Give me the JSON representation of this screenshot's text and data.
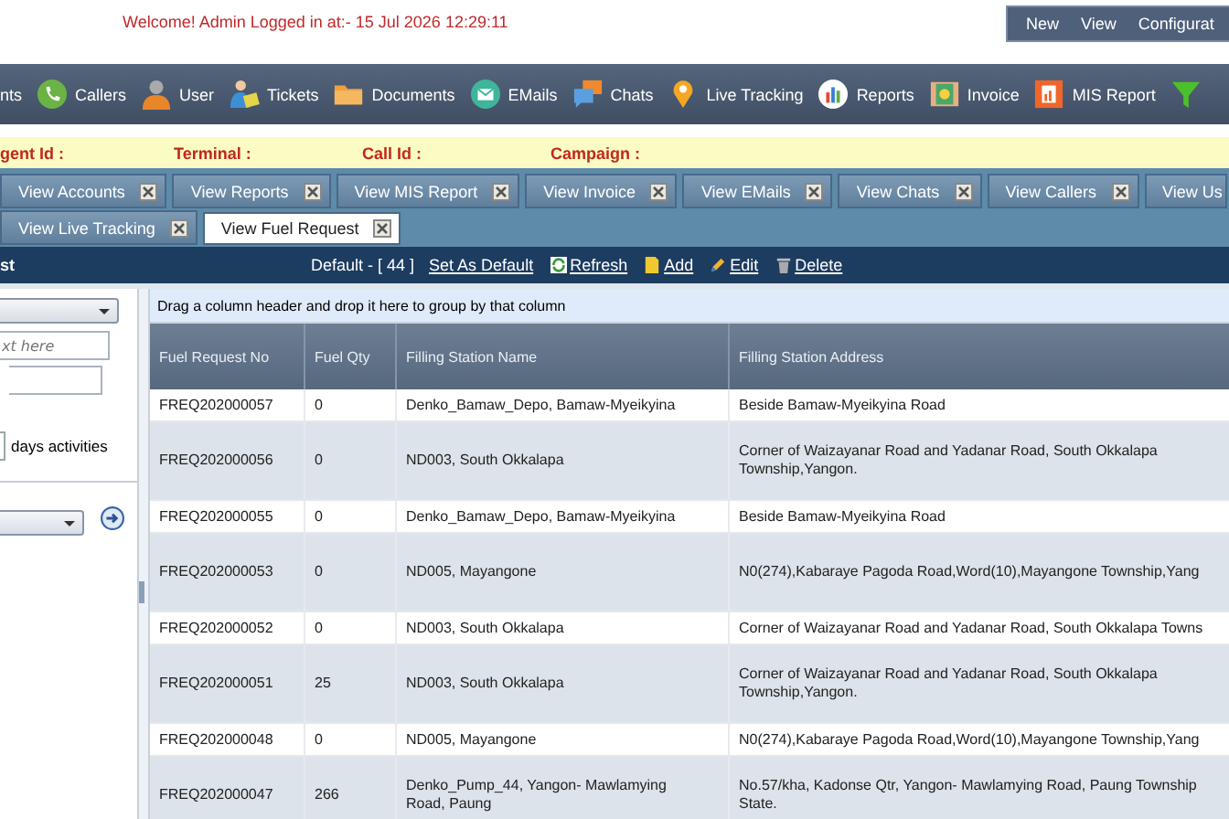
{
  "header": {
    "welcome": "Welcome! Admin Logged in at:- 15 Jul 2026 12:29:11",
    "menu": [
      "New",
      "View",
      "Configurat"
    ]
  },
  "toolbar": [
    {
      "label": "nts",
      "kind": "none"
    },
    {
      "label": "Callers",
      "kind": "phone"
    },
    {
      "label": "User",
      "kind": "user"
    },
    {
      "label": "Tickets",
      "kind": "tickets"
    },
    {
      "label": "Documents",
      "kind": "folder"
    },
    {
      "label": "EMails",
      "kind": "email"
    },
    {
      "label": "Chats",
      "kind": "chats"
    },
    {
      "label": "Live Tracking",
      "kind": "pin"
    },
    {
      "label": "Reports",
      "kind": "reports"
    },
    {
      "label": "Invoice",
      "kind": "invoice"
    },
    {
      "label": "MIS Report",
      "kind": "mis"
    },
    {
      "kind": "funnel"
    }
  ],
  "info_bar": [
    "gent Id :",
    "Terminal :",
    "Call Id :",
    "Campaign :"
  ],
  "tab_rows": [
    [
      {
        "label": "View Accounts",
        "selected": false,
        "closable": true
      },
      {
        "label": "View Reports",
        "selected": false,
        "closable": true
      },
      {
        "label": "View MIS Report",
        "selected": false,
        "closable": true
      },
      {
        "label": "View Invoice",
        "selected": false,
        "closable": true
      },
      {
        "label": "View EMails",
        "selected": false,
        "closable": true
      },
      {
        "label": "View Chats",
        "selected": false,
        "closable": true
      },
      {
        "label": "View Callers",
        "selected": false,
        "closable": true
      },
      {
        "label": "View Us",
        "selected": false,
        "closable": false
      }
    ],
    [
      {
        "label": "View Live Tracking",
        "selected": false,
        "closable": true
      },
      {
        "label": "View Fuel Request",
        "selected": true,
        "closable": true
      }
    ]
  ],
  "action_bar": {
    "title": "st",
    "view": "Default - [ 44 ]",
    "links": [
      {
        "label": "Set As Default",
        "kind": "none"
      },
      {
        "label": "Refresh",
        "kind": "refresh"
      },
      {
        "label": "Add",
        "kind": "add"
      },
      {
        "label": "Edit",
        "kind": "edit"
      },
      {
        "label": "Delete",
        "kind": "delete"
      }
    ]
  },
  "filter_panel": {
    "search_placeholder": "xt here",
    "days_label": "days activities",
    "days_checked": false
  },
  "grid": {
    "group_hint": "Drag a column header and drop it here to group by that column",
    "columns": [
      "Fuel Request No",
      "Fuel Qty",
      "Filling Station Name",
      "Filling Station Address"
    ],
    "rows": [
      {
        "request_no": "FREQ202000057",
        "fuel_qty": "0",
        "station_name": "Denko_Bamaw_Depo, Bamaw-Myeikyina",
        "address": "Beside Bamaw-Myeikyina Road"
      },
      {
        "request_no": "FREQ202000056",
        "fuel_qty": "0",
        "station_name": "ND003, South Okkalapa",
        "address": "Corner of Waizayanar Road and Yadanar Road, South Okkalapa\nTownship,Yangon."
      },
      {
        "request_no": "FREQ202000055",
        "fuel_qty": "0",
        "station_name": "Denko_Bamaw_Depo, Bamaw-Myeikyina",
        "address": "Beside Bamaw-Myeikyina Road"
      },
      {
        "request_no": "FREQ202000053",
        "fuel_qty": "0",
        "station_name": "ND005, Mayangone",
        "address": "N0(274),Kabaraye Pagoda Road,Word(10),Mayangone Township,Yang"
      },
      {
        "request_no": "FREQ202000052",
        "fuel_qty": "0",
        "station_name": "ND003, South Okkalapa",
        "address": "Corner of Waizayanar Road and Yadanar Road, South Okkalapa Towns"
      },
      {
        "request_no": "FREQ202000051",
        "fuel_qty": "25",
        "station_name": "ND003, South Okkalapa",
        "address": "Corner of Waizayanar Road and Yadanar Road, South Okkalapa\nTownship,Yangon."
      },
      {
        "request_no": "FREQ202000048",
        "fuel_qty": "0",
        "station_name": "ND005, Mayangone",
        "address": "N0(274),Kabaraye Pagoda Road,Word(10),Mayangone Township,Yang"
      },
      {
        "request_no": "FREQ202000047",
        "fuel_qty": "266",
        "station_name": "Denko_Pump_44, Yangon- Mawlamying\nRoad, Paung",
        "address": "No.57/kha, Kadonse Qtr, Yangon- Mawlamying Road, Paung Township\nState."
      }
    ]
  }
}
